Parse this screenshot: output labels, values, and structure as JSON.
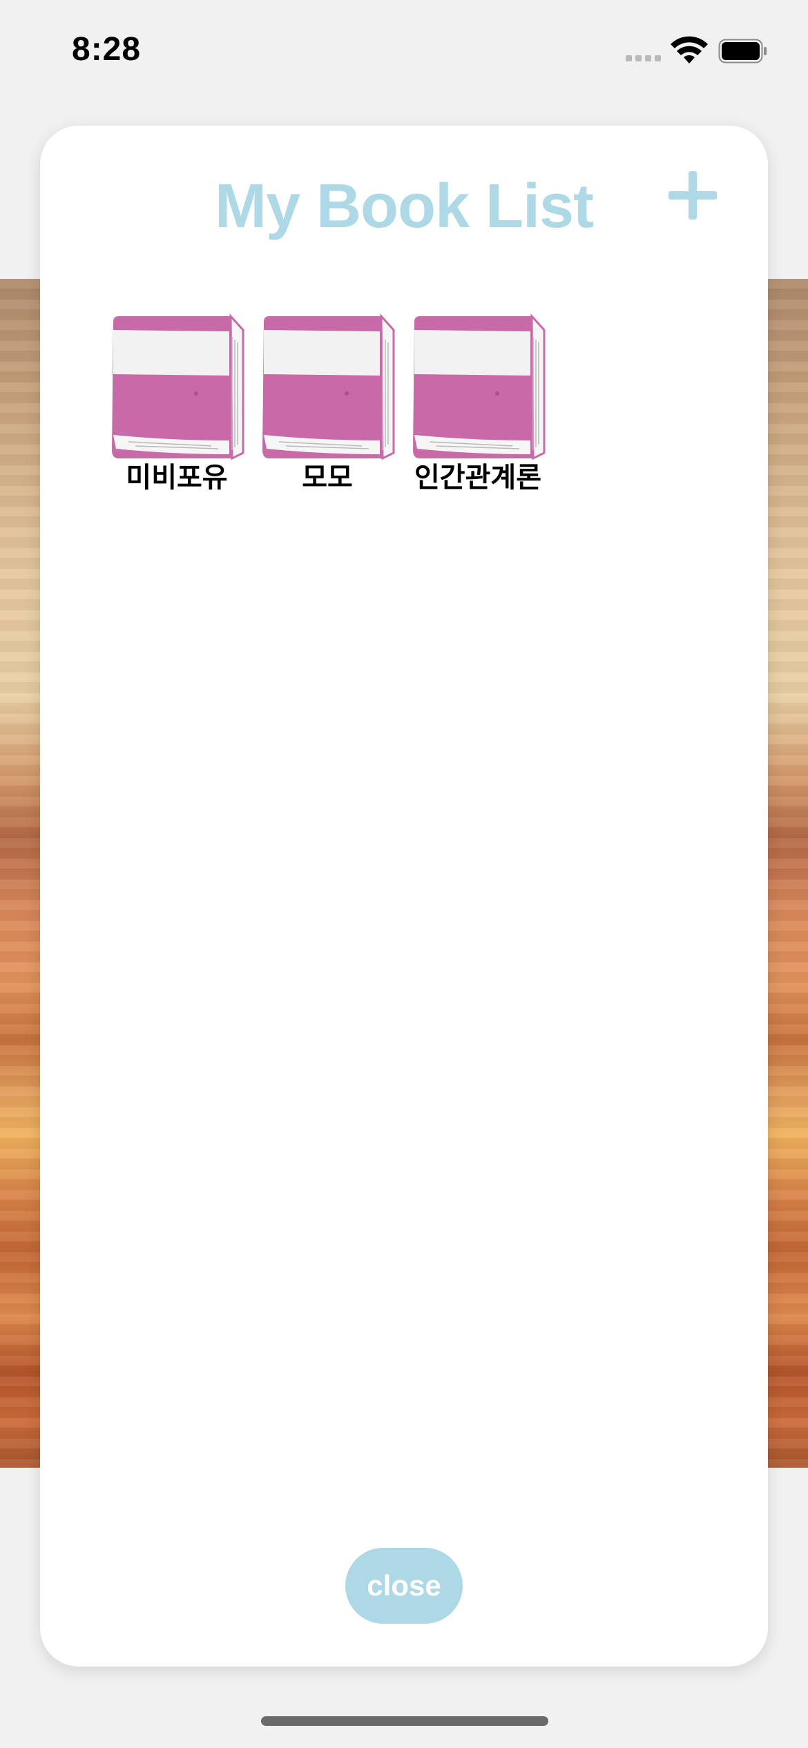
{
  "status_bar": {
    "time": "8:28"
  },
  "modal": {
    "title": "My Book List",
    "add_button_icon": "plus-icon",
    "close_label": "close"
  },
  "books": [
    {
      "title": "미비포유",
      "icon": "book-icon"
    },
    {
      "title": "모모",
      "icon": "book-icon"
    },
    {
      "title": "인간관계론",
      "icon": "book-icon"
    }
  ],
  "colors": {
    "accent": "#add8e6",
    "book_cover": "#c86aa8",
    "book_band": "#f2f2f2",
    "background": "#f1f1f1"
  }
}
